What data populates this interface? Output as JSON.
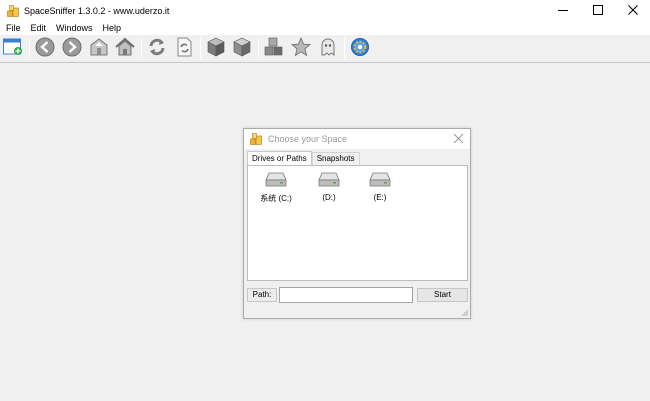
{
  "window": {
    "title": "SpaceSniffer 1.3.0.2 - www.uderzo.it",
    "controls": [
      "minimize-icon",
      "maximize-icon",
      "close-icon"
    ]
  },
  "menu": {
    "items": [
      "File",
      "Edit",
      "Windows",
      "Help"
    ]
  },
  "toolbar": {
    "buttons": [
      "new-window-icon",
      "back-icon",
      "forward-icon",
      "up-folder-icon",
      "home-icon",
      "refresh-icon",
      "refresh-page-icon",
      "cube-icon",
      "cube-alt-icon",
      "cubes-icon",
      "star-icon",
      "ghost-icon",
      "gear-icon"
    ]
  },
  "dialog": {
    "title": "Choose your Space",
    "tabs": [
      "Drives or Paths",
      "Snapshots"
    ],
    "drives": [
      {
        "label": "系统 (C:)",
        "icon": "hard-drive-icon"
      },
      {
        "label": "(D:)",
        "icon": "hard-drive-icon"
      },
      {
        "label": "(E:)",
        "icon": "hard-drive-icon"
      }
    ],
    "path_label": "Path:",
    "path_value": "",
    "start_label": "Start"
  },
  "colors": {
    "background": "#f0f0f0",
    "titlebar": "#ffffff",
    "dialog_title_text": "#999999",
    "accent_green": "#2fa84f",
    "accent_blue": "#1d6fd1"
  }
}
